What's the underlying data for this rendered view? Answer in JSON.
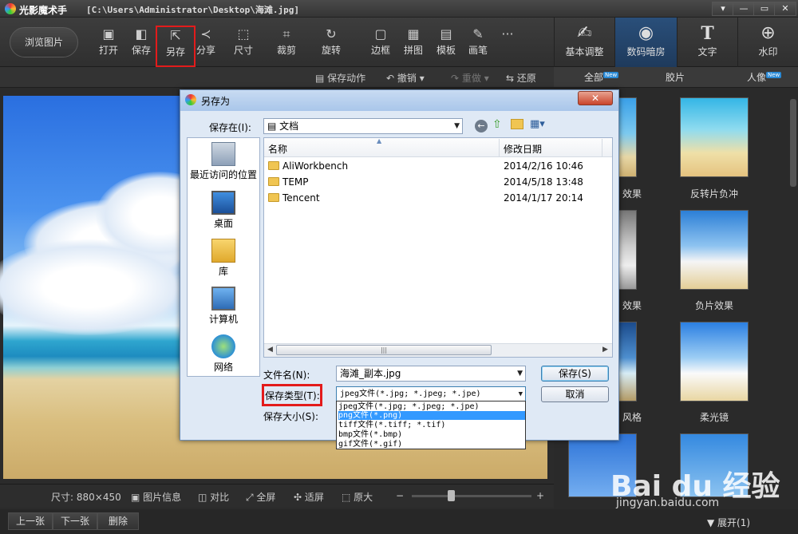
{
  "window": {
    "app_title": "光影魔术手",
    "path": "[C:\\Users\\Administrator\\Desktop\\海滩.jpg]",
    "buttons": [
      "▾",
      "—",
      "▭",
      "✕"
    ]
  },
  "toolbar": {
    "browse": "浏览图片",
    "tools": [
      {
        "label": "打开",
        "icon": "open-icon"
      },
      {
        "label": "保存",
        "icon": "save-icon"
      },
      {
        "label": "另存",
        "icon": "save-as-icon"
      },
      {
        "label": "分享",
        "icon": "share-icon"
      },
      {
        "label": "尺寸",
        "icon": "resize-icon"
      },
      {
        "label": "裁剪",
        "icon": "crop-icon"
      },
      {
        "label": "旋转",
        "icon": "rotate-icon"
      },
      {
        "label": "边框",
        "icon": "frame-icon"
      },
      {
        "label": "拼图",
        "icon": "puzzle-icon"
      },
      {
        "label": "模板",
        "icon": "template-icon"
      },
      {
        "label": "画笔",
        "icon": "brush-icon"
      },
      {
        "label": "···",
        "icon": "more-icon"
      }
    ],
    "right_tabs": [
      {
        "label": "基本调整"
      },
      {
        "label": "数码暗房"
      },
      {
        "label": "文字"
      },
      {
        "label": "水印"
      }
    ]
  },
  "subbar": {
    "save_action": "保存动作",
    "undo": "撤销",
    "redo": "重做",
    "restore": "还原"
  },
  "filter_tabs": [
    "全部",
    "胶片",
    "人像"
  ],
  "new_badge": "New",
  "filters": [
    "效果",
    "反转片负冲",
    "效果",
    "负片效果",
    "风格",
    "柔光镜"
  ],
  "bottombar": {
    "size": "尺寸: 880×450",
    "info": "图片信息",
    "compare": "对比",
    "fullscreen": "全屏",
    "fit": "适屏",
    "original": "原大"
  },
  "nav": {
    "prev": "上一张",
    "next": "下一张",
    "delete": "删除",
    "expand": "展开(1)"
  },
  "dialog": {
    "title": "另存为",
    "save_in_label": "保存在(I):",
    "save_in_value": "文档",
    "places": [
      "最近访问的位置",
      "桌面",
      "库",
      "计算机",
      "网络"
    ],
    "columns": [
      "名称",
      "修改日期"
    ],
    "files": [
      {
        "name": "AliWorkbench",
        "date": "2014/2/16 10:46"
      },
      {
        "name": "TEMP",
        "date": "2014/5/18 13:48"
      },
      {
        "name": "Tencent",
        "date": "2014/1/17 20:14"
      }
    ],
    "filename_label": "文件名(N):",
    "filename_value": "海滩_副本.jpg",
    "type_label": "保存类型(T):",
    "type_value": "jpeg文件(*.jpg; *.jpeg; *.jpe)",
    "size_label": "保存大小(S):",
    "save_btn": "保存(S)",
    "cancel_btn": "取消",
    "type_options": [
      "jpeg文件(*.jpg; *.jpeg; *.jpe)",
      "png文件(*.png)",
      "tiff文件(*.tiff; *.tif)",
      "bmp文件(*.bmp)",
      "gif文件(*.gif)"
    ],
    "selected_option": 1
  },
  "watermark": {
    "brand": "Bai du 经验",
    "url": "jingyan.baidu.com"
  }
}
